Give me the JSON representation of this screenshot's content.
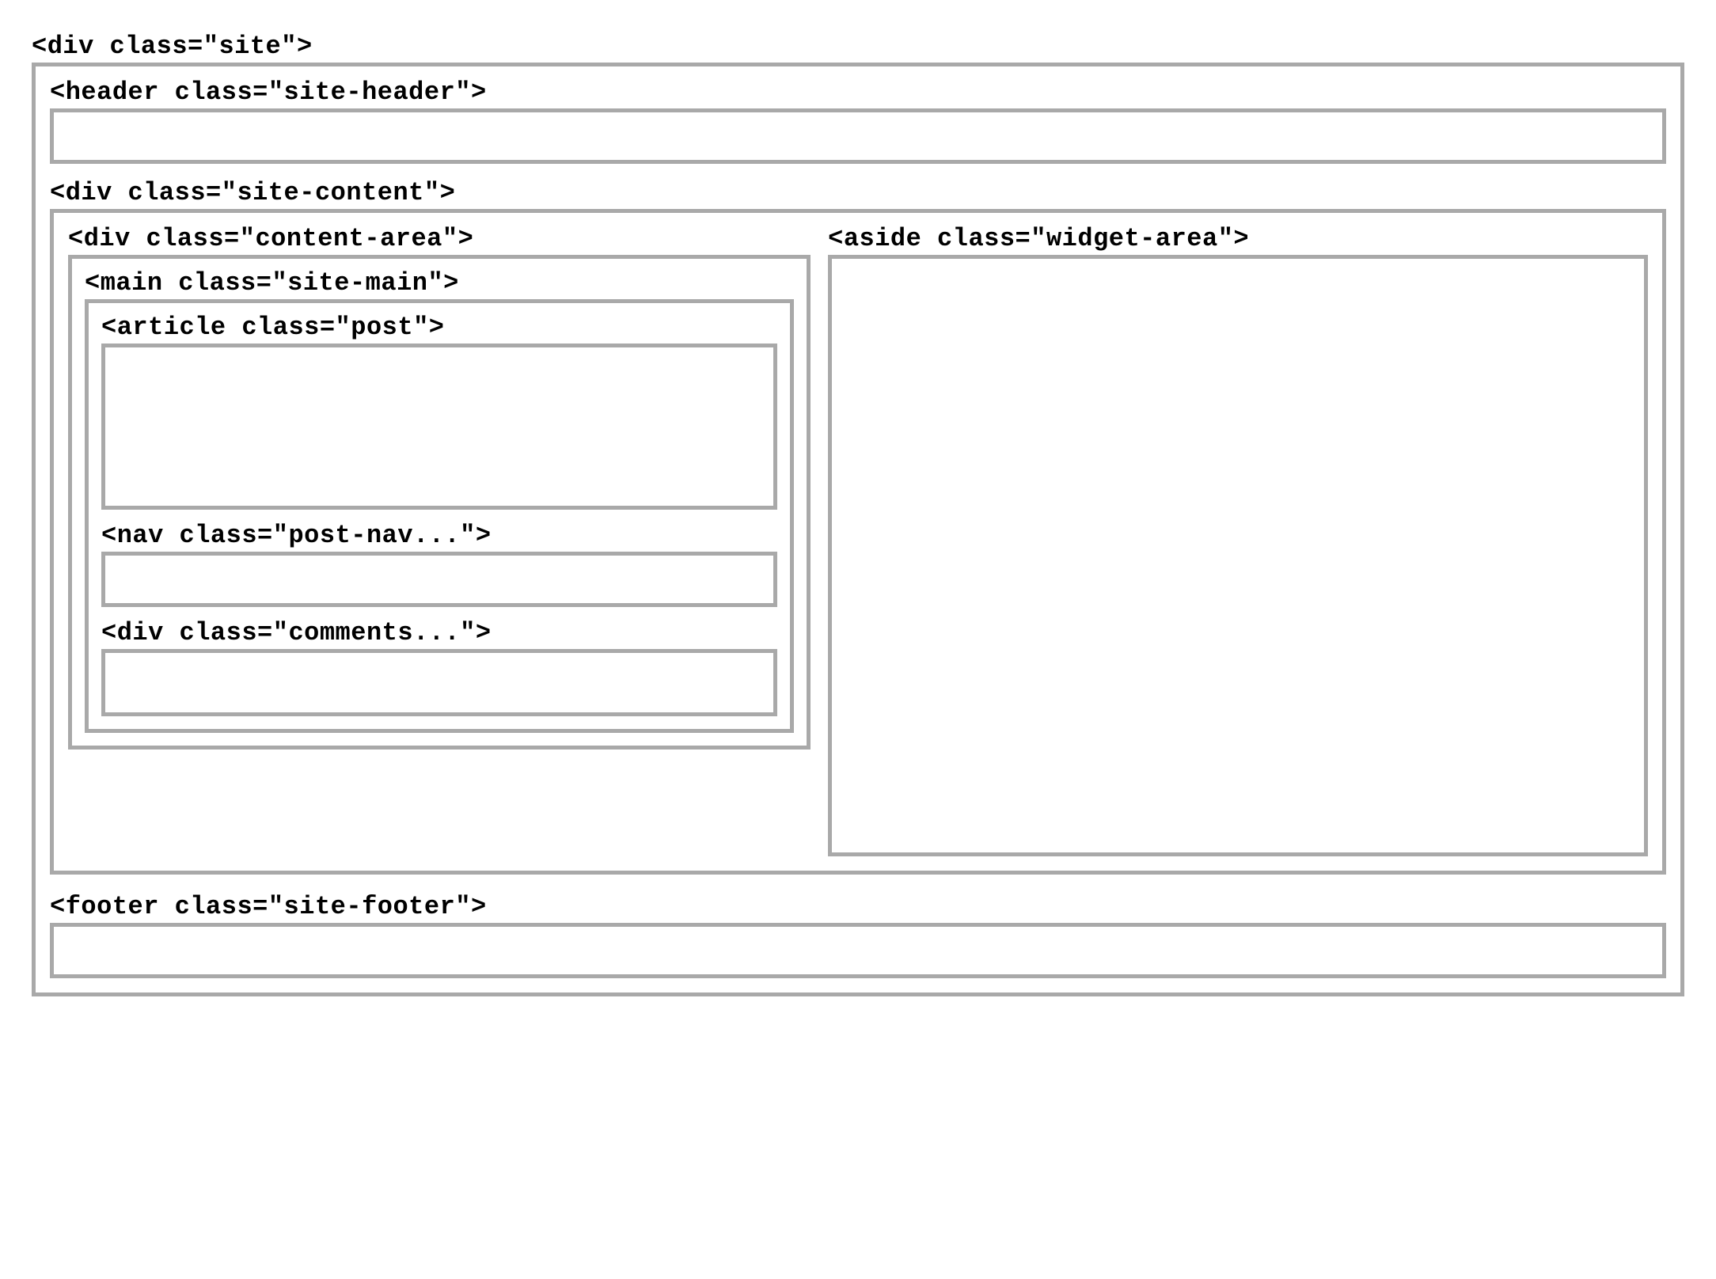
{
  "labels": {
    "site": "<div class=\"site\">",
    "site_header": "<header class=\"site-header\">",
    "site_content": "<div class=\"site-content\">",
    "content_area": "<div class=\"content-area\">",
    "site_main": "<main class=\"site-main\">",
    "article_post": "<article class=\"post\">",
    "post_nav": "<nav class=\"post-nav...\">",
    "comments": "<div class=\"comments...\">",
    "widget_area": "<aside class=\"widget-area\">",
    "site_footer": "<footer class=\"site-footer\">"
  }
}
